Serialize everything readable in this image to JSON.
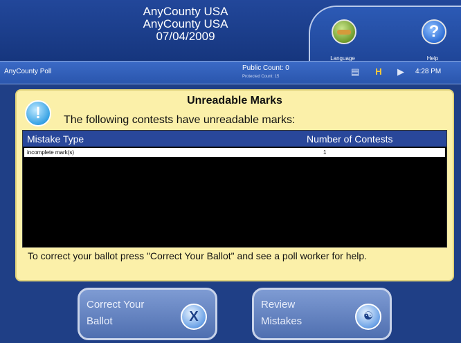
{
  "header": {
    "lines": [
      "AnyCounty USA",
      "AnyCounty USA",
      "07/04/2009"
    ],
    "buttons": {
      "language_label": "Language",
      "help_label": "Help"
    }
  },
  "status": {
    "poll_name": "AnyCounty Poll",
    "public_count": "Public Count: 0",
    "protected_count": "Protected Count: 15",
    "time": "4:28 PM",
    "icons": [
      "document-icon",
      "save-icon",
      "speaker-icon"
    ]
  },
  "dialog": {
    "title": "Unreadable Marks",
    "subtitle": "The following contests have unreadable marks:",
    "table": {
      "columns": [
        "Mistake Type",
        "Number of Contests"
      ],
      "rows": [
        [
          "incomplete mark(s)",
          "1"
        ]
      ]
    },
    "footer": "To correct your ballot press \"Correct Your Ballot\" and see a poll worker for help."
  },
  "actions": {
    "correct_label_line1": "Correct Your",
    "correct_label_line2": "Ballot",
    "review_label_line1": "Review",
    "review_label_line2": "Mistakes"
  },
  "colors": {
    "background": "#1f3f86",
    "dialog_bg": "#fbf0a9",
    "table_header": "#29479a"
  }
}
